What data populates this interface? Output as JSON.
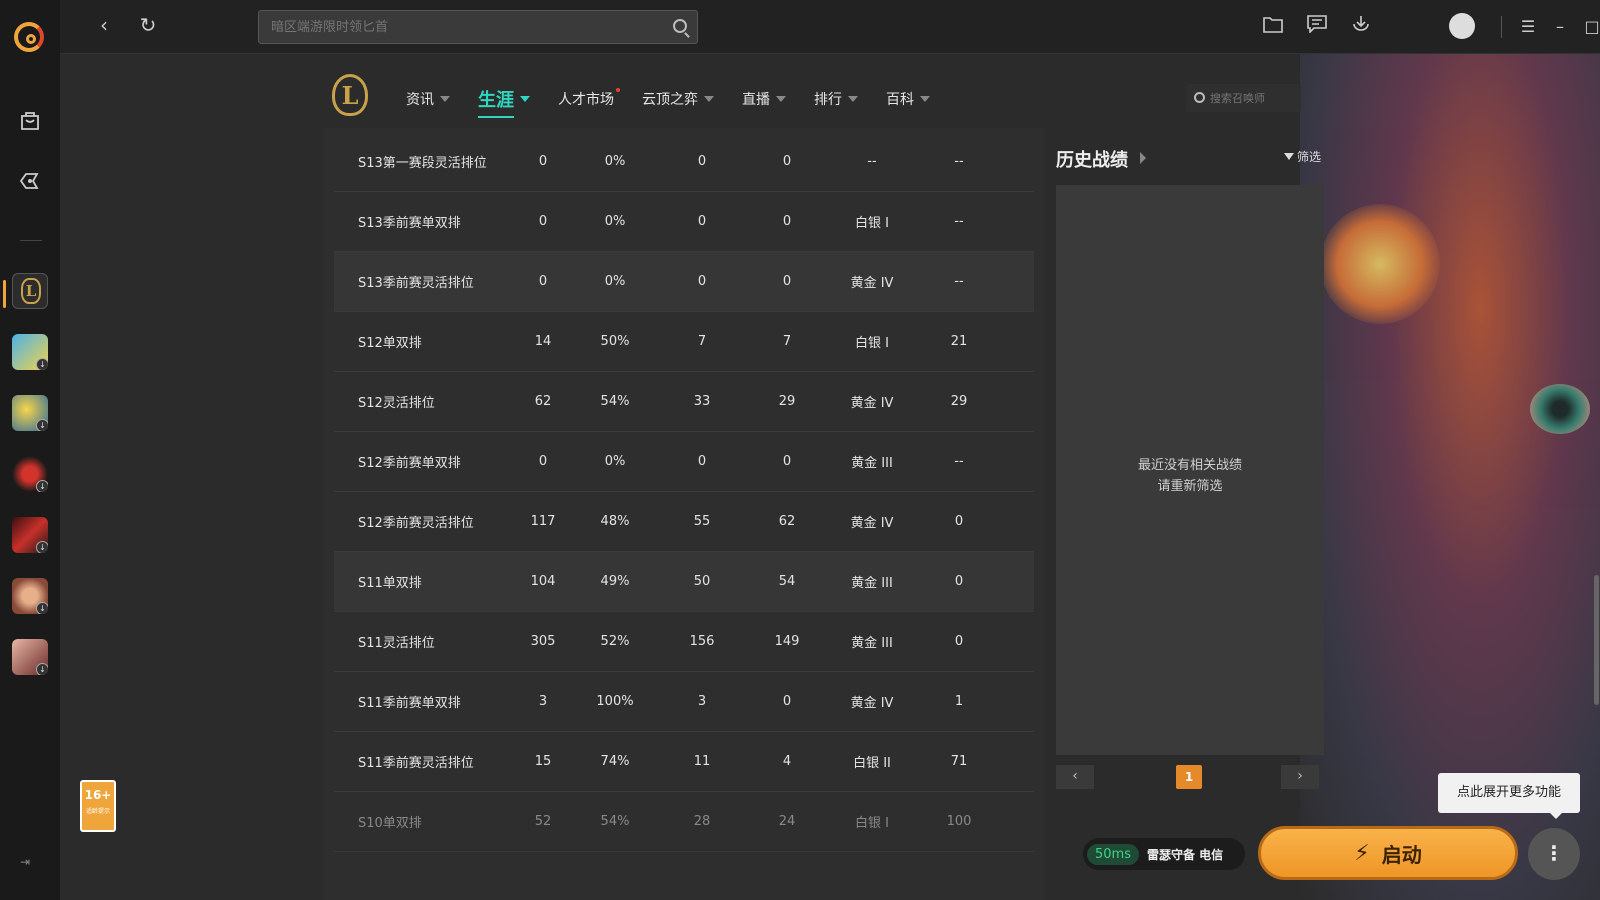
{
  "topbar": {
    "search_placeholder": "暗区端游限时领匕首"
  },
  "page": {
    "tabs": [
      {
        "label": "资讯",
        "has_caret": true
      },
      {
        "label": "生涯",
        "has_caret": true,
        "active": true
      },
      {
        "label": "人才市场",
        "has_caret": false,
        "dot": true
      },
      {
        "label": "云顶之弈",
        "has_caret": true
      },
      {
        "label": "直播",
        "has_caret": true
      },
      {
        "label": "排行",
        "has_caret": true
      },
      {
        "label": "百科",
        "has_caret": true
      }
    ],
    "search_placeholder": "搜索召唤师"
  },
  "table": {
    "rows": [
      [
        "S13第一赛段灵活排位",
        "0",
        "0%",
        "0",
        "0",
        "--",
        "--"
      ],
      [
        "S13季前赛单双排",
        "0",
        "0%",
        "0",
        "0",
        "白银 I",
        "--"
      ],
      [
        "S13季前赛灵活排位",
        "0",
        "0%",
        "0",
        "0",
        "黄金 IV",
        "--"
      ],
      [
        "S12单双排",
        "14",
        "50%",
        "7",
        "7",
        "白银 I",
        "21"
      ],
      [
        "S12灵活排位",
        "62",
        "54%",
        "33",
        "29",
        "黄金 IV",
        "29"
      ],
      [
        "S12季前赛单双排",
        "0",
        "0%",
        "0",
        "0",
        "黄金 III",
        "--"
      ],
      [
        "S12季前赛灵活排位",
        "117",
        "48%",
        "55",
        "62",
        "黄金 IV",
        "0"
      ],
      [
        "S11单双排",
        "104",
        "49%",
        "50",
        "54",
        "黄金 III",
        "0"
      ],
      [
        "S11灵活排位",
        "305",
        "52%",
        "156",
        "149",
        "黄金 III",
        "0"
      ],
      [
        "S11季前赛单双排",
        "3",
        "100%",
        "3",
        "0",
        "黄金 IV",
        "1"
      ],
      [
        "S11季前赛灵活排位",
        "15",
        "74%",
        "11",
        "4",
        "白银 II",
        "71"
      ],
      [
        "S10单双排",
        "52",
        "54%",
        "28",
        "24",
        "白银 I",
        "100"
      ]
    ]
  },
  "history": {
    "title": "历史战绩",
    "filter_label": "筛选",
    "empty_line1": "最近没有相关战绩",
    "empty_line2": "请重新筛选",
    "prev": "‹",
    "next": "›",
    "page": "1"
  },
  "bottom": {
    "ping": "50ms",
    "isp": "雷瑟守备 电信",
    "launch_label": "启动",
    "tooltip": "点此展开更多功能"
  },
  "age_badge": {
    "label": "16+",
    "caption": "适龄提示"
  },
  "colors": {
    "accent_teal": "#2fd6c0",
    "launch_orange": "#f9b24a",
    "ping_green": "#3fd38a"
  }
}
